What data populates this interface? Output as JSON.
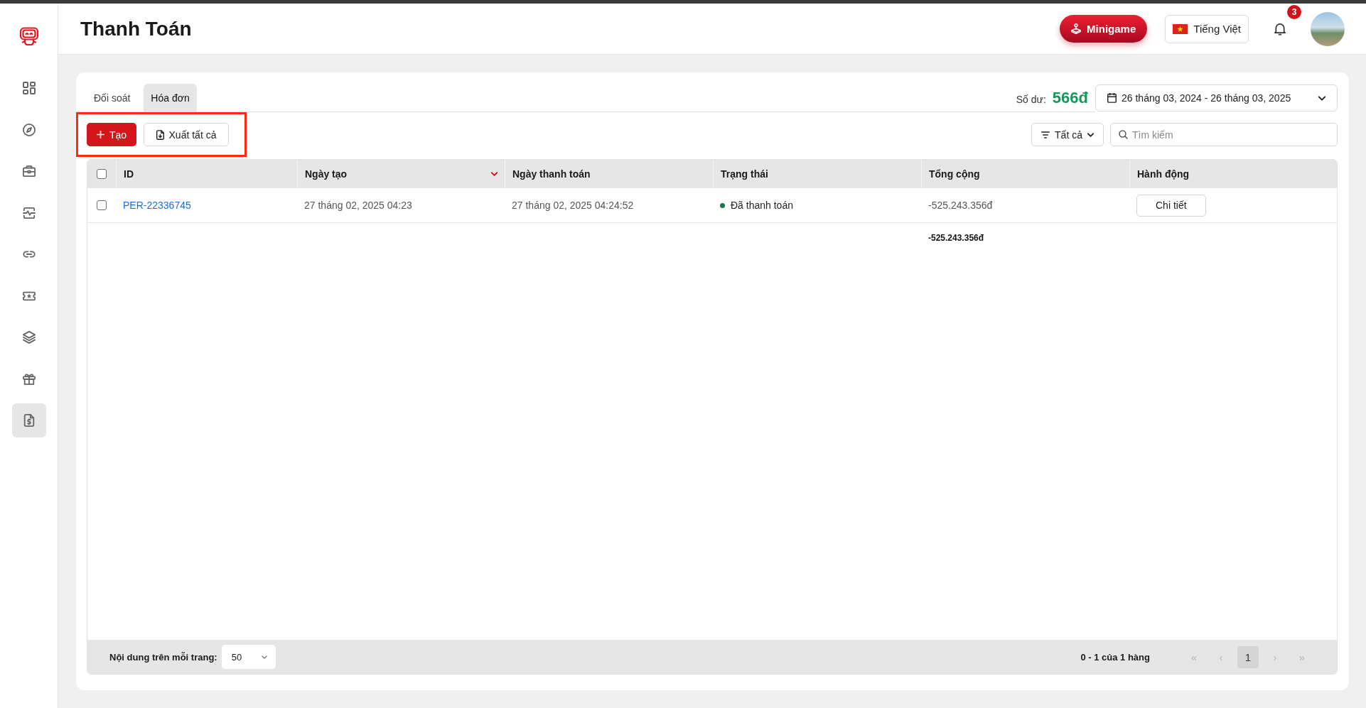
{
  "sidebar": {
    "items": [
      {
        "selected": false
      },
      {
        "selected": false
      },
      {
        "selected": false
      },
      {
        "selected": false
      },
      {
        "selected": false
      },
      {
        "selected": false
      },
      {
        "selected": false
      },
      {
        "selected": false
      },
      {
        "selected": true
      }
    ]
  },
  "header": {
    "title": "Thanh Toán",
    "minigame_button": "Minigame",
    "language_button": "Tiếng Việt",
    "notification_count": "3"
  },
  "tabs": [
    {
      "label": "Đối soát",
      "selected": false
    },
    {
      "label": "Hóa đơn",
      "selected": true
    }
  ],
  "balance": {
    "label": "Số dư:",
    "value": "566đ"
  },
  "date_range": "26 tháng 03, 2024 - 26 tháng 03, 2025",
  "toolbar": {
    "highlighted": true,
    "create_button": "Tạo",
    "export_button": "Xuất tất cả",
    "filter": "Tất cả",
    "search": {
      "placeholder": "Tìm kiếm"
    }
  },
  "table": {
    "select_all_checked": false,
    "columns": [
      {
        "label": "ID",
        "sorted": false
      },
      {
        "label": "Ngày tạo",
        "sorted": true
      },
      {
        "label": "Ngày thanh toán",
        "sorted": false
      },
      {
        "label": "Trạng thái",
        "sorted": false
      },
      {
        "label": "Tổng cộng",
        "sorted": false
      },
      {
        "label": "Hành động",
        "sorted": false
      }
    ],
    "rows": [
      {
        "checked": false,
        "id": "PER-22336745",
        "created": "27 tháng 02, 2025 04:23",
        "paid": "27 tháng 02, 2025 04:24:52",
        "status": {
          "label": "Đã thanh toán",
          "color": "#0e7a4d"
        },
        "total": "-525.243.356đ",
        "action": "Chi tiết"
      }
    ],
    "summary_total": "-525.243.356đ"
  },
  "pagination": {
    "rows_per_page_label": "Nội dung trên mỗi trang:",
    "rows_per_page": "50",
    "range": "0 - 1 của 1 hàng",
    "first": {
      "label": "«",
      "disabled": true
    },
    "previous": {
      "label": "‹",
      "disabled": true
    },
    "pages": [
      {
        "label": "1",
        "selected": true
      }
    ],
    "next": {
      "label": "›",
      "disabled": true
    },
    "last": {
      "label": "»",
      "disabled": true
    }
  }
}
